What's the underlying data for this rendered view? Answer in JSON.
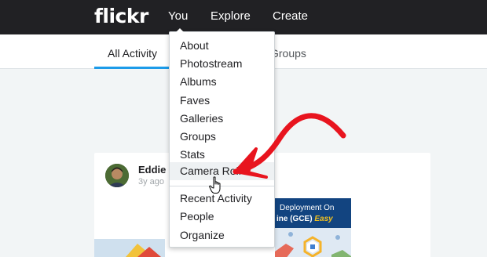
{
  "header": {
    "logo": "flickr",
    "nav": {
      "you": "You",
      "explore": "Explore",
      "create": "Create"
    }
  },
  "subnav": {
    "tabs": [
      {
        "label": "All Activity"
      },
      {
        "label": "Groups"
      }
    ],
    "accent_color": "#1c9be9"
  },
  "feed": {
    "author": "Eddie",
    "time_ago": "3y ago",
    "thumbnail": {
      "line1": "Deployment On",
      "line2_a": "ine (GCE)",
      "line2_b": "Easy"
    }
  },
  "menu": {
    "items": [
      {
        "label": "About"
      },
      {
        "label": "Photostream"
      },
      {
        "label": "Albums"
      },
      {
        "label": "Faves"
      },
      {
        "label": "Galleries"
      },
      {
        "label": "Groups"
      },
      {
        "label": "Stats"
      },
      {
        "label": "Camera Roll"
      },
      {
        "label": "Recent Activity"
      },
      {
        "label": "People"
      },
      {
        "label": "Organize"
      }
    ],
    "highlighted": "Camera Roll"
  },
  "annotation": {
    "arrow_color": "#e8141e"
  },
  "icons": {
    "cursor": "hand-pointer-icon",
    "annotation": "red-arrow-icon"
  }
}
